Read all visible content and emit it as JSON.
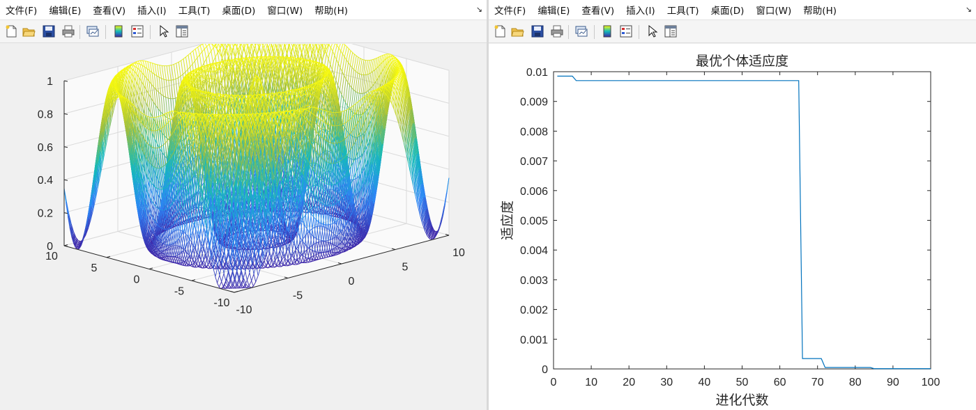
{
  "menus": [
    "文件(F)",
    "编辑(E)",
    "查看(V)",
    "插入(I)",
    "工具(T)",
    "桌面(D)",
    "窗口(W)",
    "帮助(H)"
  ],
  "menu_arrow": "↘",
  "toolbar_icons": [
    "new-figure-icon",
    "open-file-icon",
    "save-icon",
    "print-icon",
    "link-plot-icon",
    "insert-colorbar-icon",
    "insert-legend-icon",
    "edit-plot-arrow-icon",
    "property-inspector-icon"
  ],
  "colors": {
    "surface_low": "#3e26a8",
    "surface_mid": "#13bbbb",
    "surface_high": "#f9fb0e",
    "line_series": "#0072bd"
  },
  "chart_data": [
    {
      "type": "surface",
      "title": "",
      "zticks": [
        "0",
        "0.2",
        "0.4",
        "0.6",
        "0.8",
        "1"
      ],
      "xticks": [
        "-10",
        "-5",
        "0",
        "5",
        "10"
      ],
      "yticks": [
        "10",
        "5",
        "0",
        "-5",
        "-10"
      ],
      "xlim": [
        -10,
        10
      ],
      "ylim": [
        -10,
        10
      ],
      "zlim": [
        0,
        1
      ],
      "colormap": "parula",
      "grid": true
    },
    {
      "type": "line",
      "title": "最优个体适应度",
      "xlabel": "进化代数",
      "ylabel": "适应度",
      "xlim": [
        0,
        100
      ],
      "ylim": [
        0,
        0.01
      ],
      "xticks": [
        "0",
        "10",
        "20",
        "30",
        "40",
        "50",
        "60",
        "70",
        "80",
        "90",
        "100"
      ],
      "yticks": [
        "0",
        "0.001",
        "0.002",
        "0.003",
        "0.004",
        "0.005",
        "0.006",
        "0.007",
        "0.008",
        "0.009",
        "0.01"
      ],
      "x": [
        1,
        5,
        6,
        65,
        66,
        71,
        72,
        84,
        85,
        100
      ],
      "y": [
        0.00985,
        0.00985,
        0.0097,
        0.0097,
        0.00035,
        0.00035,
        5e-05,
        5e-05,
        1e-05,
        1e-05
      ]
    }
  ]
}
